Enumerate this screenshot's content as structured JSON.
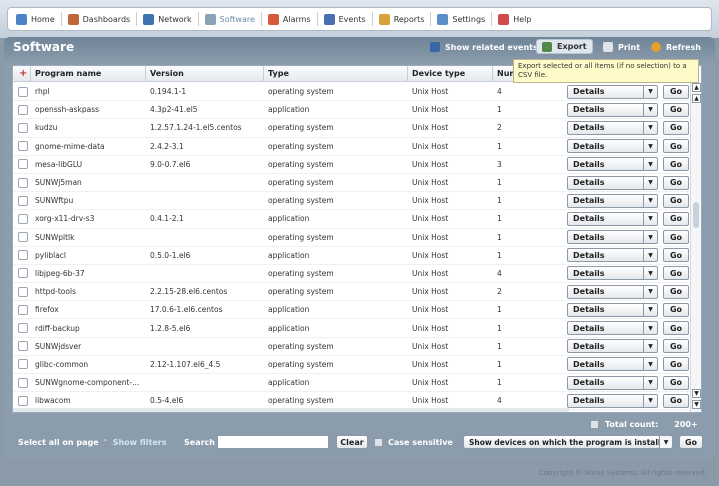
{
  "nav": {
    "items": [
      {
        "label": "Home",
        "icon": "home-icon",
        "color": "#4b83c4"
      },
      {
        "label": "Dashboards",
        "icon": "dashboard-icon",
        "color": "#c0673a"
      },
      {
        "label": "Network",
        "icon": "network-icon",
        "color": "#3f74b3"
      },
      {
        "label": "Software",
        "icon": "software-icon",
        "color": "#8aa2b8"
      },
      {
        "label": "Alarms",
        "icon": "alarm-icon",
        "color": "#d65a3a"
      },
      {
        "label": "Events",
        "icon": "events-icon",
        "color": "#4a6fb0"
      },
      {
        "label": "Reports",
        "icon": "reports-icon",
        "color": "#d8a23a"
      },
      {
        "label": "Settings",
        "icon": "settings-icon",
        "color": "#5a8fc9"
      },
      {
        "label": "Help",
        "icon": "help-icon",
        "color": "#d44a4a"
      }
    ],
    "active_index": 3
  },
  "panel": {
    "title": "Software",
    "show_related_events": "Show related events",
    "export": "Export",
    "print": "Print",
    "refresh": "Refresh",
    "tooltip": "Export selected or all items (if no selection) to a CSV file."
  },
  "table": {
    "columns": {
      "plus": "+",
      "name": "Program name",
      "version": "Version",
      "type": "Type",
      "device_type": "Device type",
      "number": "Num"
    },
    "details_label": "Details",
    "go_label": "Go",
    "rows": [
      {
        "name": "rhpl",
        "version": "0.194.1-1",
        "type": "operating system",
        "device": "Unix Host",
        "num": "4"
      },
      {
        "name": "openssh-askpass",
        "version": "4.3p2-41.el5",
        "type": "application",
        "device": "Unix Host",
        "num": "1"
      },
      {
        "name": "kudzu",
        "version": "1.2.57.1.24-1.el5.centos",
        "type": "operating system",
        "device": "Unix Host",
        "num": "2"
      },
      {
        "name": "gnome-mime-data",
        "version": "2.4.2-3.1",
        "type": "operating system",
        "device": "Unix Host",
        "num": "1"
      },
      {
        "name": "mesa-libGLU",
        "version": "9.0-0.7.el6",
        "type": "operating system",
        "device": "Unix Host",
        "num": "3"
      },
      {
        "name": "SUNWj5man",
        "version": "",
        "type": "operating system",
        "device": "Unix Host",
        "num": "1"
      },
      {
        "name": "SUNWftpu",
        "version": "",
        "type": "operating system",
        "device": "Unix Host",
        "num": "1"
      },
      {
        "name": "xorg-x11-drv-s3",
        "version": "0.4.1-2.1",
        "type": "application",
        "device": "Unix Host",
        "num": "1"
      },
      {
        "name": "SUNWpltlk",
        "version": "",
        "type": "operating system",
        "device": "Unix Host",
        "num": "1"
      },
      {
        "name": "pyliblacl",
        "version": "0.5.0-1.el6",
        "type": "application",
        "device": "Unix Host",
        "num": "1"
      },
      {
        "name": "libjpeg-6b-37",
        "version": "",
        "type": "operating system",
        "device": "Unix Host",
        "num": "4"
      },
      {
        "name": "httpd-tools",
        "version": "2.2.15-28.el6.centos",
        "type": "operating system",
        "device": "Unix Host",
        "num": "2"
      },
      {
        "name": "firefox",
        "version": "17.0.6-1.el6.centos",
        "type": "application",
        "device": "Unix Host",
        "num": "1"
      },
      {
        "name": "rdiff-backup",
        "version": "1.2.8-5.el6",
        "type": "application",
        "device": "Unix Host",
        "num": "1"
      },
      {
        "name": "SUNWjdsver",
        "version": "",
        "type": "operating system",
        "device": "Unix Host",
        "num": "1"
      },
      {
        "name": "glibc-common",
        "version": "2.12-1.107.el6_4.5",
        "type": "operating system",
        "device": "Unix Host",
        "num": "1"
      },
      {
        "name": "SUNWgnome-component-...",
        "version": "",
        "type": "application",
        "device": "Unix Host",
        "num": "1"
      },
      {
        "name": "libwacom",
        "version": "0.5-4.el6",
        "type": "operating system",
        "device": "Unix Host",
        "num": "4"
      }
    ]
  },
  "footer": {
    "total_label": "Total count:",
    "total_value": "200+",
    "select_all": "Select all on page",
    "show_filters": "Show filters",
    "search_label": "Search",
    "search_value": "",
    "clear": "Clear",
    "case_sensitive": "Case sensitive",
    "show_devices": "Show devices on which the program is installed",
    "go": "Go",
    "copyright": "Copyright © Vorax Systems. All rights reserved."
  }
}
